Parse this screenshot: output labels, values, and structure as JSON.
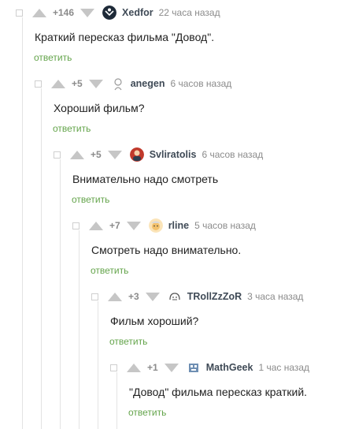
{
  "comments": [
    {
      "rating": "+146",
      "nick": "Xedfor",
      "time": "22 часа назад",
      "text": "Краткий пересказ фильма \"Довод\".",
      "reply": "ответить",
      "avatar_color": "#1e2a38"
    },
    {
      "rating": "+5",
      "nick": "anegen",
      "time": "6 часов назад",
      "text": "Хороший фильм?",
      "reply": "ответить",
      "avatar_color": "#9a9a9a"
    },
    {
      "rating": "+5",
      "nick": "Svliratolis",
      "time": "6 часов назад",
      "text": "Внимательно надо смотреть",
      "reply": "ответить",
      "avatar_color": "#c0392b"
    },
    {
      "rating": "+7",
      "nick": "rline",
      "time": "5 часов назад",
      "text": "Смотреть надо внимательно.",
      "reply": "ответить",
      "avatar_color": "#f3c16b"
    },
    {
      "rating": "+3",
      "nick": "TRollZzZoR",
      "time": "3 часа назад",
      "text": "Фильм хороший?",
      "reply": "ответить",
      "avatar_color": "#555555"
    },
    {
      "rating": "+1",
      "nick": "MathGeek",
      "time": "1 час назад",
      "text": "\"Довод\" фильма пересказ краткий.",
      "reply": "ответить",
      "avatar_color": "#6f8fb3"
    }
  ],
  "icons": {
    "toggle": "collapse-toggle-icon",
    "upvote": "upvote-arrow-icon",
    "downvote": "downvote-arrow-icon"
  },
  "colors": {
    "reply_link": "#64a44b",
    "nick": "#3f4a56",
    "meta": "#8b8b8b",
    "vote_arrow": "#c6c6c6"
  }
}
